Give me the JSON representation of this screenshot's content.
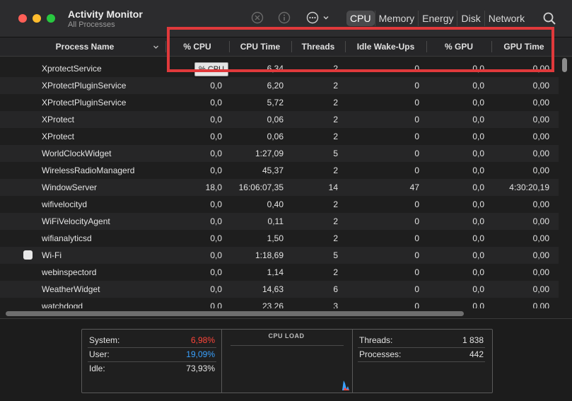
{
  "app": {
    "title": "Activity Monitor",
    "subtitle": "All Processes"
  },
  "toolbar": {
    "tabs": [
      {
        "label": "CPU",
        "active": true
      },
      {
        "label": "Memory",
        "active": false
      },
      {
        "label": "Energy",
        "active": false
      },
      {
        "label": "Disk",
        "active": false
      },
      {
        "label": "Network",
        "active": false
      }
    ],
    "icons": [
      "stop-process-icon",
      "inspect-info-icon",
      "more-actions-icon",
      "search-icon"
    ]
  },
  "columns": {
    "name": "Process Name",
    "cpu": "% CPU",
    "cpu_time": "CPU Time",
    "threads": "Threads",
    "idle_wakeups": "Idle Wake-Ups",
    "gpu": "% GPU",
    "gpu_time": "GPU Time"
  },
  "tooltip": "% CPU",
  "processes": [
    {
      "name": "XprotectService",
      "cpu": "",
      "cpu_time": "6,34",
      "threads": "2",
      "idle": "0",
      "gpu": "0,0",
      "gpu_time": "0,00"
    },
    {
      "name": "XProtectPluginService",
      "cpu": "0,0",
      "cpu_time": "6,20",
      "threads": "2",
      "idle": "0",
      "gpu": "0,0",
      "gpu_time": "0,00"
    },
    {
      "name": "XProtectPluginService",
      "cpu": "0,0",
      "cpu_time": "5,72",
      "threads": "2",
      "idle": "0",
      "gpu": "0,0",
      "gpu_time": "0,00"
    },
    {
      "name": "XProtect",
      "cpu": "0,0",
      "cpu_time": "0,06",
      "threads": "2",
      "idle": "0",
      "gpu": "0,0",
      "gpu_time": "0,00"
    },
    {
      "name": "XProtect",
      "cpu": "0,0",
      "cpu_time": "0,06",
      "threads": "2",
      "idle": "0",
      "gpu": "0,0",
      "gpu_time": "0,00"
    },
    {
      "name": "WorldClockWidget",
      "cpu": "0,0",
      "cpu_time": "1:27,09",
      "threads": "5",
      "idle": "0",
      "gpu": "0,0",
      "gpu_time": "0,00"
    },
    {
      "name": "WirelessRadioManagerd",
      "cpu": "0,0",
      "cpu_time": "45,37",
      "threads": "2",
      "idle": "0",
      "gpu": "0,0",
      "gpu_time": "0,00"
    },
    {
      "name": "WindowServer",
      "cpu": "18,0",
      "cpu_time": "16:06:07,35",
      "threads": "14",
      "idle": "47",
      "gpu": "0,0",
      "gpu_time": "4:30:20,19"
    },
    {
      "name": "wifivelocityd",
      "cpu": "0,0",
      "cpu_time": "0,40",
      "threads": "2",
      "idle": "0",
      "gpu": "0,0",
      "gpu_time": "0,00"
    },
    {
      "name": "WiFiVelocityAgent",
      "cpu": "0,0",
      "cpu_time": "0,11",
      "threads": "2",
      "idle": "0",
      "gpu": "0,0",
      "gpu_time": "0,00"
    },
    {
      "name": "wifianalyticsd",
      "cpu": "0,0",
      "cpu_time": "1,50",
      "threads": "2",
      "idle": "0",
      "gpu": "0,0",
      "gpu_time": "0,00"
    },
    {
      "name": "Wi-Fi",
      "cpu": "0,0",
      "cpu_time": "1:18,69",
      "threads": "5",
      "idle": "0",
      "gpu": "0,0",
      "gpu_time": "0,00",
      "has_icon": true
    },
    {
      "name": "webinspectord",
      "cpu": "0,0",
      "cpu_time": "1,14",
      "threads": "2",
      "idle": "0",
      "gpu": "0,0",
      "gpu_time": "0,00"
    },
    {
      "name": "WeatherWidget",
      "cpu": "0,0",
      "cpu_time": "14,63",
      "threads": "6",
      "idle": "0",
      "gpu": "0,0",
      "gpu_time": "0,00"
    },
    {
      "name": "watchdogd",
      "cpu": "0,0",
      "cpu_time": "23,26",
      "threads": "3",
      "idle": "0",
      "gpu": "0,0",
      "gpu_time": "0,00"
    }
  ],
  "stats": {
    "system_label": "System:",
    "system_value": "6,98%",
    "user_label": "User:",
    "user_value": "19,09%",
    "idle_label": "Idle:",
    "idle_value": "73,93%",
    "cpu_load_title": "CPU LOAD",
    "threads_label": "Threads:",
    "threads_value": "1 838",
    "processes_label": "Processes:",
    "processes_value": "442"
  },
  "colors": {
    "system": "#ff453a",
    "user": "#3aa2ff",
    "highlight": "#e0393b"
  }
}
